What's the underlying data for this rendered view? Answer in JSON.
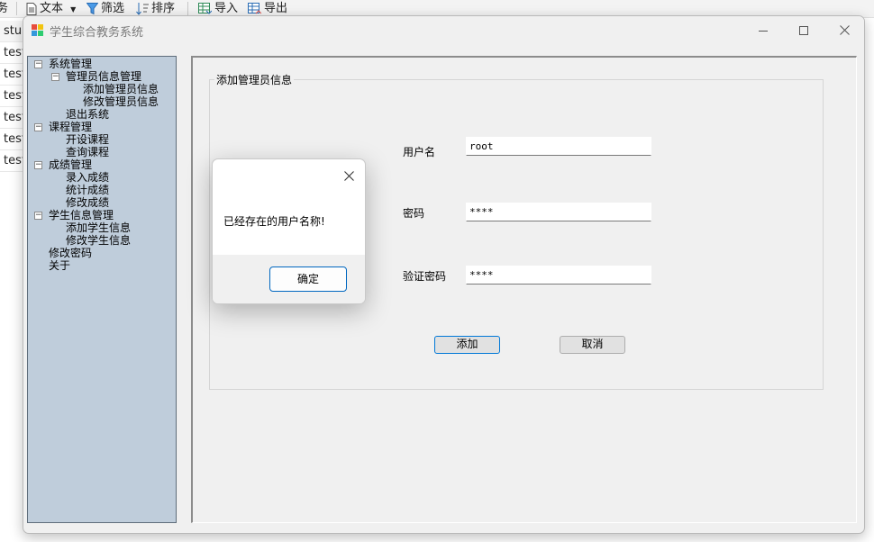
{
  "background": {
    "toolbar": {
      "partial_left": "务",
      "text_label": "文本",
      "filter_label": "筛选",
      "sort_label": "排序",
      "import_label": "导入",
      "export_label": "导出"
    },
    "rows": [
      "stu",
      "test",
      "test",
      "test",
      "test",
      "test",
      "test"
    ]
  },
  "window": {
    "title": "学生综合教务系统",
    "icons": [
      "app-icon",
      "minimize-icon",
      "maximize-icon",
      "close-icon"
    ]
  },
  "tree": {
    "n1": "系统管理",
    "n2": "管理员信息管理",
    "n3": "添加管理员信息",
    "n4": "修改管理员信息",
    "n5": "退出系统",
    "n6": "课程管理",
    "n7": "开设课程",
    "n8": "查询课程",
    "n9": "成绩管理",
    "n10": "录入成绩",
    "n11": "统计成绩",
    "n12": "修改成绩",
    "n13": "学生信息管理",
    "n14": "添加学生信息",
    "n15": "修改学生信息",
    "n16": "修改密码",
    "n17": "关于",
    "toggle_glyph": "−"
  },
  "form": {
    "group_title": "添加管理员信息",
    "username_label": "用户名",
    "username_value": "root",
    "password_label": "密码",
    "password_value": "****",
    "confirm_label": "验证密码",
    "confirm_value": "****",
    "add_label": "添加",
    "cancel_label": "取消"
  },
  "dialog": {
    "message": "已经存在的用户名称!",
    "ok_label": "确定"
  },
  "colors": {
    "tree_bg": "#bfcddb",
    "window_bg": "#f0f0f0",
    "accent": "#0078d7"
  }
}
